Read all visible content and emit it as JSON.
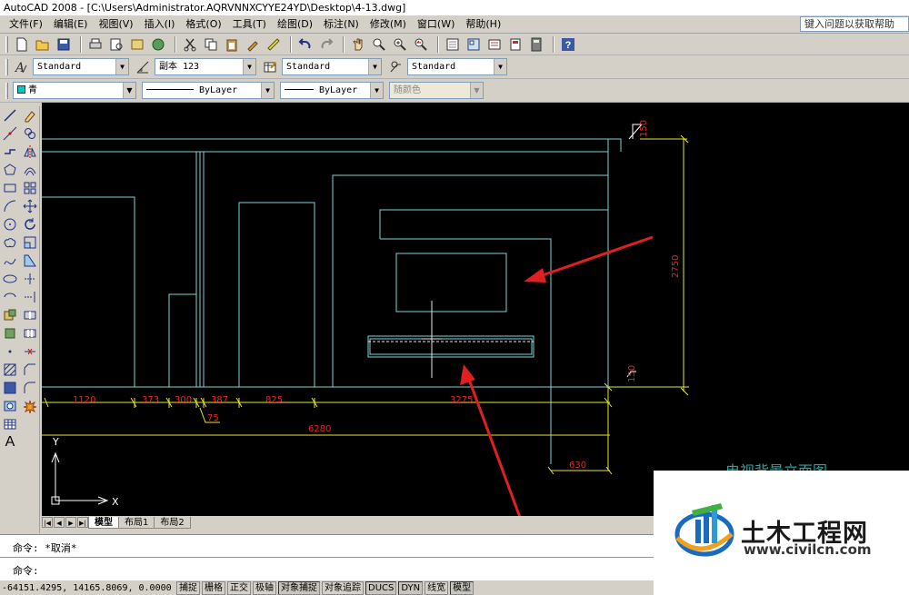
{
  "window": {
    "title": "AutoCAD 2008 - [C:\\Users\\Administrator.AQRVNNXCYYE24YD\\Desktop\\4-13.dwg]"
  },
  "menubar": {
    "items": [
      "文件(F)",
      "编辑(E)",
      "视图(V)",
      "插入(I)",
      "格式(O)",
      "工具(T)",
      "绘图(D)",
      "标注(N)",
      "修改(M)",
      "窗口(W)",
      "帮助(H)"
    ],
    "help_search": "键入问题以获取帮助"
  },
  "styles_toolbar": {
    "text_style": "Standard",
    "dim_style": "副本 123",
    "table_style": "Standard",
    "multileader_style": "Standard"
  },
  "layers_toolbar": {
    "color": "青",
    "linetype": "ByLayer",
    "lineweight": "ByLayer",
    "plot_style": "随颜色"
  },
  "drawing": {
    "dimensions": {
      "d1120": "1120",
      "d373": "373",
      "d300": "300",
      "d387": "387",
      "d825": "825",
      "d3275": "3275",
      "d75": "75",
      "d6280": "6280",
      "d630": "630",
      "d2750": "2750",
      "d150top": "150",
      "d150bot": "150"
    },
    "caption": "电视背景立面图",
    "ucs": {
      "x": "X",
      "y": "Y"
    },
    "colors": {
      "cyan": "#7fd4d4",
      "dim_red": "#e02828",
      "dim_yellow": "#e6e632",
      "arrow_red": "#e02020",
      "caption": "#2aa4a4"
    }
  },
  "layout_tabs": [
    "模型",
    "布局1",
    "布局2"
  ],
  "command": {
    "line1": "命令: *取消*",
    "line2": "命令:"
  },
  "statusbar": {
    "coords": "-64151.4295, 14165.8069, 0.0000",
    "toggles": [
      "捕捉",
      "栅格",
      "正交",
      "极轴",
      "对象捕捉",
      "对象追踪",
      "DUCS",
      "DYN",
      "线宽",
      "模型"
    ]
  },
  "watermark": {
    "name": "土木工程网",
    "url": "www.civilcn.com"
  }
}
